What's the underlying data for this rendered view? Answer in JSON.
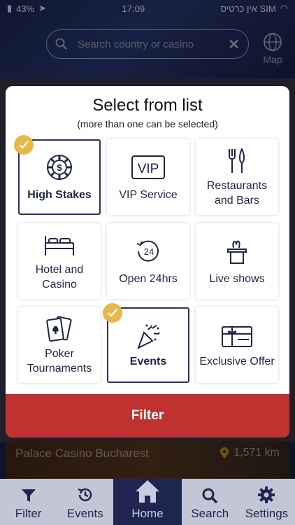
{
  "status": {
    "carrier": "אין כרטיס SIM",
    "time": "17:09",
    "battery": "43%"
  },
  "header": {
    "search_placeholder": "Search country or casino",
    "map_label": "Map"
  },
  "background_card": {
    "title": "Palace Casino Bucharest",
    "distance": "1,571 km"
  },
  "modal": {
    "title": "Select from list",
    "subtitle": "(more than one can be selected)",
    "items": [
      {
        "label": "High Stakes",
        "icon": "chip-icon",
        "selected": true
      },
      {
        "label": "VIP Service",
        "icon": "vip-icon",
        "selected": false
      },
      {
        "label": "Restaurants and Bars",
        "icon": "fork-knife-icon",
        "selected": false
      },
      {
        "label": "Hotel and Casino",
        "icon": "bed-icon",
        "selected": false
      },
      {
        "label": "Open 24hrs",
        "icon": "clock-24-icon",
        "selected": false
      },
      {
        "label": "Live shows",
        "icon": "magic-hat-icon",
        "selected": false
      },
      {
        "label": "Poker Tournaments",
        "icon": "cards-icon",
        "selected": false
      },
      {
        "label": "Events",
        "icon": "party-popper-icon",
        "selected": true
      },
      {
        "label": "Exclusive Offer",
        "icon": "gift-card-icon",
        "selected": false
      }
    ],
    "filter_label": "Filter"
  },
  "tabbar": {
    "tabs": [
      {
        "label": "Filter",
        "icon": "filter-icon"
      },
      {
        "label": "Events",
        "icon": "history-icon"
      },
      {
        "label": "Home",
        "icon": "home-icon"
      },
      {
        "label": "Search",
        "icon": "search-icon"
      },
      {
        "label": "Settings",
        "icon": "gear-icon"
      }
    ]
  },
  "colors": {
    "accent": "#c0322f",
    "check": "#e8b84a",
    "navy": "#1e2650"
  }
}
